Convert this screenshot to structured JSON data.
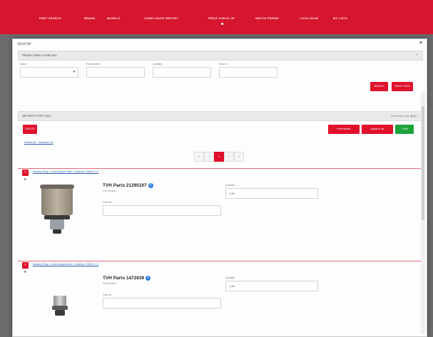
{
  "nav": {
    "items": [
      {
        "label": "PART SEARCH"
      },
      {
        "label": "BRAND"
      },
      {
        "label": "MODELS"
      },
      {
        "label": "COMPLIANCE REPORT"
      },
      {
        "label": "PRICE CHECK UP"
      },
      {
        "label": "WATCH FRIEND"
      },
      {
        "label": "CATALOGUE"
      },
      {
        "label": "MY LISTS"
      }
    ]
  },
  "modal": {
    "title": "Sprot list",
    "close": "×",
    "filter_bar": {
      "label": "Please make a selection",
      "action": "+"
    },
    "filters": {
      "name_label": "Name",
      "name_value": "",
      "part_label": "Part number",
      "part_value": "",
      "quantity_label": "Quantity",
      "quantity_value": "",
      "row_label": "Row nr",
      "row_value": ""
    },
    "search_button": "SEARCH",
    "reset_button": "RESET DATA",
    "results_bar": {
      "label": "SEARCH FOR 13x1",
      "right": "Results per page  ▦ ▤  ×"
    },
    "delete_button": "DELETE",
    "print_button": "Print marker",
    "update_button": "Adjust in list",
    "add_button": "+ Add",
    "select_link": "Select all  ·  Deselect all",
    "pagination": [
      {
        "label": "«",
        "active": false
      },
      {
        "label": "‹",
        "active": false
      },
      {
        "label": "1",
        "active": true
      },
      {
        "label": "›",
        "active": false
      },
      {
        "label": "»",
        "active": false
      }
    ],
    "items": [
      {
        "badge": "×",
        "link": "Autokey Shop > Lorem ipsum dolor > Vivamus 2 MKS 2 0 1",
        "title": "TVH Parts 21295107",
        "sub": "Fuel strainer",
        "qty_label": "Quantity",
        "qty_value": "1,00",
        "note_label": "Your ref",
        "note_value": ""
      },
      {
        "badge": "×",
        "link": "Autokey Shop > Lorem ipsum dolor > Vivamus 2 MKS 2 0 1",
        "title": "TVH Parts 1472639",
        "sub": "Fuel strainer",
        "qty_label": "Quantity",
        "qty_value": "1,00",
        "note_label": "Your ref",
        "note_value": ""
      }
    ]
  },
  "colors": {
    "brand": "#d6162f",
    "accent_red": "#e0112b",
    "green": "#1ca33b"
  }
}
